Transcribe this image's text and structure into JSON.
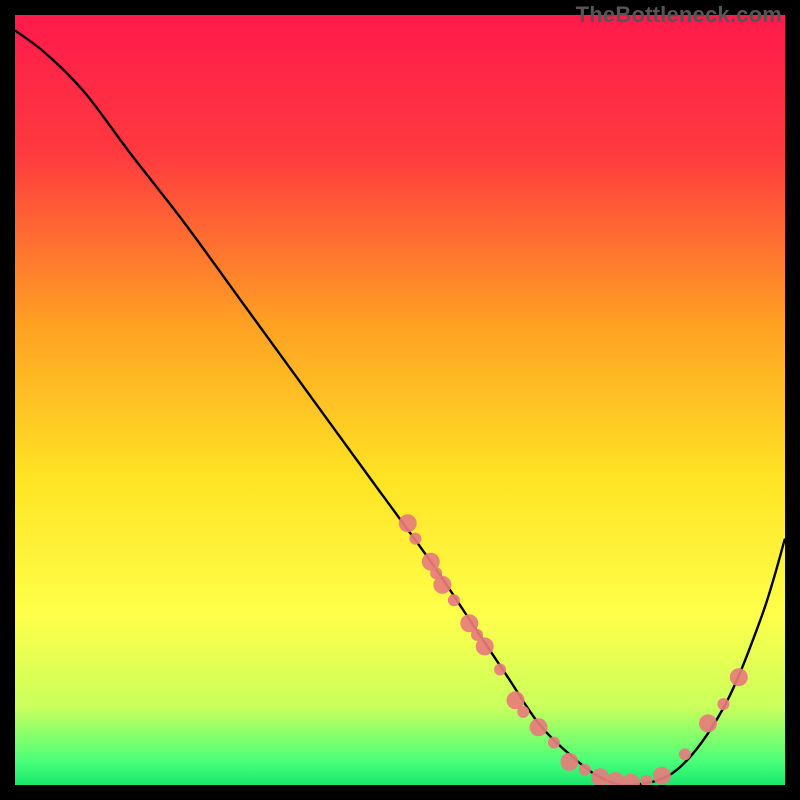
{
  "watermark": "TheBottleneck.com",
  "chart_data": {
    "type": "line",
    "title": "",
    "xlabel": "",
    "ylabel": "",
    "xlim": [
      0,
      100
    ],
    "ylim": [
      0,
      100
    ],
    "grid": false,
    "gradient_stops": [
      {
        "offset": 0,
        "color": "#ff1a4b"
      },
      {
        "offset": 18,
        "color": "#ff3a3f"
      },
      {
        "offset": 40,
        "color": "#ffa023"
      },
      {
        "offset": 60,
        "color": "#ffe324"
      },
      {
        "offset": 78,
        "color": "#ffff4a"
      },
      {
        "offset": 90,
        "color": "#c8ff5d"
      },
      {
        "offset": 97,
        "color": "#49ff79"
      },
      {
        "offset": 100,
        "color": "#17e86b"
      }
    ],
    "series": [
      {
        "name": "bottleneck-curve",
        "x": [
          0,
          4,
          9,
          15,
          22,
          30,
          38,
          46,
          54,
          60,
          64,
          68,
          72,
          76,
          80,
          86,
          92,
          97,
          100
        ],
        "y": [
          98,
          95,
          90,
          82,
          73,
          62,
          51,
          40,
          29,
          20,
          14,
          8,
          4,
          1,
          0,
          2,
          10,
          22,
          32
        ]
      }
    ],
    "scatter": {
      "name": "gpu-points",
      "color": "#e77c7c",
      "radius_small": 6,
      "radius_large": 9,
      "points": [
        {
          "x": 51,
          "y": 34,
          "r": "large"
        },
        {
          "x": 52,
          "y": 32,
          "r": "small"
        },
        {
          "x": 54,
          "y": 29,
          "r": "large"
        },
        {
          "x": 54.7,
          "y": 27.5,
          "r": "small"
        },
        {
          "x": 55.5,
          "y": 26,
          "r": "large"
        },
        {
          "x": 57,
          "y": 24,
          "r": "small"
        },
        {
          "x": 59,
          "y": 21,
          "r": "large"
        },
        {
          "x": 60,
          "y": 19.5,
          "r": "small"
        },
        {
          "x": 61,
          "y": 18,
          "r": "large"
        },
        {
          "x": 63,
          "y": 15,
          "r": "small"
        },
        {
          "x": 65,
          "y": 11,
          "r": "large"
        },
        {
          "x": 66,
          "y": 9.5,
          "r": "small"
        },
        {
          "x": 68,
          "y": 7.5,
          "r": "large"
        },
        {
          "x": 70,
          "y": 5.5,
          "r": "small"
        },
        {
          "x": 72,
          "y": 3,
          "r": "large"
        },
        {
          "x": 74,
          "y": 2,
          "r": "small"
        },
        {
          "x": 76,
          "y": 1,
          "r": "large"
        },
        {
          "x": 78,
          "y": 0.5,
          "r": "large"
        },
        {
          "x": 80,
          "y": 0.3,
          "r": "large"
        },
        {
          "x": 82,
          "y": 0.5,
          "r": "small"
        },
        {
          "x": 84,
          "y": 1.2,
          "r": "large"
        },
        {
          "x": 87,
          "y": 4,
          "r": "small"
        },
        {
          "x": 90,
          "y": 8,
          "r": "large"
        },
        {
          "x": 92,
          "y": 10.5,
          "r": "small"
        },
        {
          "x": 94,
          "y": 14,
          "r": "large"
        }
      ]
    }
  }
}
